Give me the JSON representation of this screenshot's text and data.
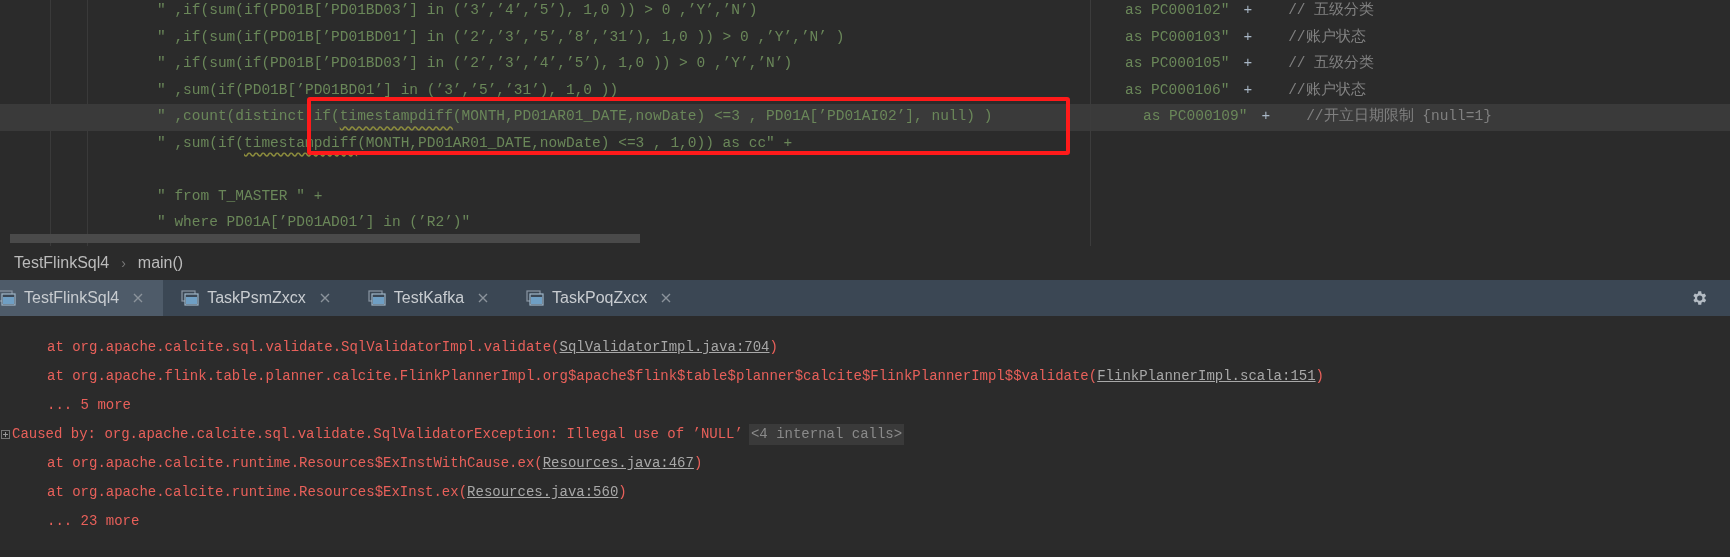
{
  "editor": {
    "left_lines": [
      {
        "current": false,
        "segments": [
          {
            "text": "″ ,if(sum(if(PD01B[’PD01BD03’] in (’3’,’4’,’5’), 1,0 )) > 0 ,’Y’,’N’)",
            "kind": "plain"
          }
        ]
      },
      {
        "current": false,
        "segments": [
          {
            "text": "″ ,if(sum(if(PD01B[’PD01BD01’] in (’2’,’3’,’5’,’8’,’31’), 1,0 )) > 0 ,’Y’,’N’ )",
            "kind": "plain"
          }
        ]
      },
      {
        "current": false,
        "segments": [
          {
            "text": "″ ,if(sum(if(PD01B[’PD01BD03’] in (’2’,’3’,’4’,’5’), 1,0 )) > 0 ,’Y’,’N’)",
            "kind": "plain"
          }
        ]
      },
      {
        "current": false,
        "segments": [
          {
            "text": "″ ,sum(if(PD01B[’PD01BD01’] in (’3’,’5’,’31’), 1,0 ))",
            "kind": "plain"
          }
        ]
      },
      {
        "current": true,
        "segments": [
          {
            "text": "″ ,count(distinct if(",
            "kind": "plain"
          },
          {
            "text": "timestampdiff",
            "kind": "warning"
          },
          {
            "text": "(MONTH,PD01AR01_DATE,nowDate) <=3 , PD01A[’PD01AI02’], null) )",
            "kind": "plain"
          }
        ]
      },
      {
        "current": false,
        "segments": [
          {
            "text": "″ ,sum(if(",
            "kind": "plain"
          },
          {
            "text": "timestampdiff",
            "kind": "warning"
          },
          {
            "text": "(MONTH,PD01AR01_DATE,nowDate) <=3 , 1,0)) as cc″ +",
            "kind": "plain"
          }
        ]
      },
      {
        "current": false
      },
      {
        "current": false,
        "segments": [
          {
            "text": "″ from T_MASTER ″ +",
            "kind": "plain"
          }
        ]
      },
      {
        "current": false,
        "segments": [
          {
            "text": "″ where PD01A[’PD01AD01’] in (’R2’)″",
            "kind": "plain"
          }
        ]
      }
    ],
    "right_lines": [
      {
        "current": false,
        "code": "as PC000102″",
        "plus": "+",
        "comment": "// 五级分类"
      },
      {
        "current": false,
        "code": "as PC000103″",
        "plus": "+",
        "comment": "//账户状态"
      },
      {
        "current": false,
        "code": "as PC000105″",
        "plus": "+",
        "comment": "// 五级分类"
      },
      {
        "current": false,
        "code": "as PC000106″",
        "plus": "+",
        "comment": "//账户状态"
      },
      {
        "current": true,
        "code": "as PC000109″",
        "plus": "+",
        "comment": "//开立日期限制 {null=1}"
      }
    ]
  },
  "breadcrumb": {
    "items": [
      "TestFlinkSql4",
      "main()"
    ],
    "separator": "›"
  },
  "run_tabs": [
    {
      "label": "TestFlinkSql4",
      "selected": true
    },
    {
      "label": "TaskPsmZxcx",
      "selected": false
    },
    {
      "label": "TestKafka",
      "selected": false
    },
    {
      "label": "TaskPoqZxcx",
      "selected": false
    }
  ],
  "console": [
    {
      "kind": "frame",
      "text": "at org.apache.calcite.sql.validate.SqlValidatorImpl.validate(",
      "link": "SqlValidatorImpl.java:704",
      "end": ")"
    },
    {
      "kind": "frame",
      "text": "at org.apache.flink.table.planner.calcite.FlinkPlannerImpl.org$apache$flink$table$planner$calcite$FlinkPlannerImpl$$validate(",
      "link": "FlinkPlannerImpl.scala:151",
      "end": ")"
    },
    {
      "kind": "more",
      "text": "... 5 more"
    },
    {
      "kind": "cause",
      "text": "Caused by: org.apache.calcite.sql.validate.SqlValidatorException: Illegal use of ’NULL’",
      "badge": "<4 internal calls>"
    },
    {
      "kind": "frame",
      "text": "at org.apache.calcite.runtime.Resources$ExInstWithCause.ex(",
      "link": "Resources.java:467",
      "end": ")"
    },
    {
      "kind": "frame",
      "text": "at org.apache.calcite.runtime.Resources$ExInst.ex(",
      "link": "Resources.java:560",
      "end": ")"
    },
    {
      "kind": "more",
      "text": "... 23 more"
    }
  ]
}
